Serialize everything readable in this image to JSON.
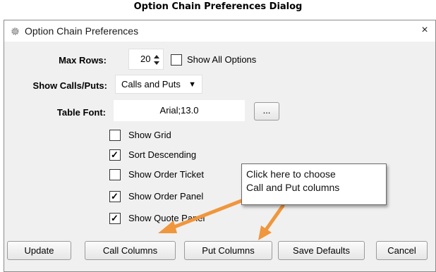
{
  "caption": "Option Chain Preferences Dialog",
  "dialog": {
    "title": "Option Chain Preferences",
    "close_label": "×",
    "title_icon": "gear-icon"
  },
  "max_rows": {
    "label": "Max Rows:",
    "value": "20",
    "show_all_label": "Show All Options",
    "show_all_checked": false
  },
  "show_calls_puts": {
    "label": "Show Calls/Puts:",
    "selected": "Calls and Puts"
  },
  "table_font": {
    "label": "Table Font:",
    "value": "Arial;13.0",
    "browse_label": "..."
  },
  "options": [
    {
      "label": "Show Grid",
      "checked": false
    },
    {
      "label": "Sort Descending",
      "checked": true
    },
    {
      "label": "Show Order Ticket",
      "checked": false
    },
    {
      "label": "Show Order Panel",
      "checked": true
    },
    {
      "label": "Show Quote Panel",
      "checked": true
    }
  ],
  "buttons": {
    "update": "Update",
    "call_columns": "Call Columns",
    "put_columns": "Put Columns",
    "save_defaults": "Save Defaults",
    "cancel": "Cancel"
  },
  "callout": {
    "line1": "Click here to choose",
    "line2": "Call and Put columns"
  },
  "colors": {
    "arrow": "#f0963c",
    "dialog_bg": "#f0f0f0"
  }
}
